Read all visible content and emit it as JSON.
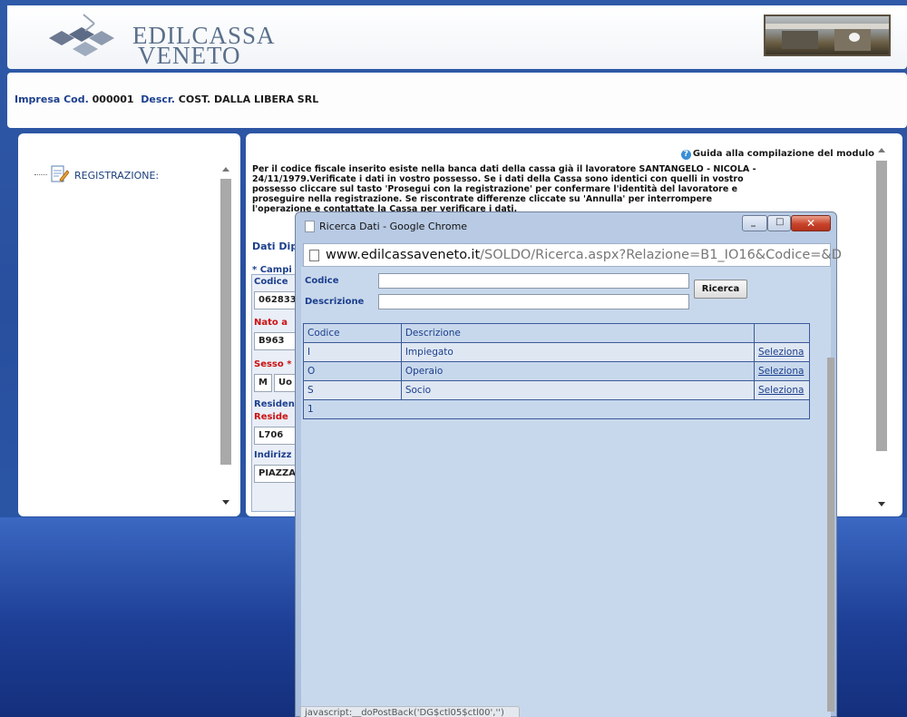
{
  "header": {
    "logo_line1": "EDILCASSA",
    "logo_line2": "VENETO"
  },
  "company": {
    "code_label": "Impresa Cod.",
    "code": "000001",
    "descr_label": "Descr.",
    "descr": "COST. DALLA LIBERA SRL"
  },
  "sidebar": {
    "items": [
      {
        "label": "REGISTRAZIONE:"
      }
    ]
  },
  "main": {
    "help_link": "Guida alla compilazione del modulo",
    "info_text": "Per il codice fiscale inserito esiste nella banca dati della cassa già il lavoratore SANTANGELO - NICOLA - 24/11/1979.Verificate i dati in vostro possesso. Se i dati della Cassa sono identici con quelli in vostro possesso cliccare sul tasto 'Prosegui con la registrazione' per confermare l'identità del lavoratore e proseguire nella registrazione. Se riscontrate differenze cliccate su 'Annulla' per interrompere l'operazione e contattate la Cassa per verificare i dati.",
    "section_title": "Dati Dip",
    "required_note": "* Campi",
    "fields": {
      "codice_label": "Codice",
      "codice_value": "062833",
      "nato_label": "Nato a",
      "nato_value": "B963",
      "sesso_label": "Sesso *",
      "sesso_code": "M",
      "sesso_desc": "Uo",
      "residenza_label": "Residen",
      "residenza_req_label": "Reside",
      "residenza_value": "L706",
      "indirizzo_label": "Indirizz",
      "indirizzo_value": "PIAZZA"
    }
  },
  "popup": {
    "title": "Ricerca Dati - Google Chrome",
    "url_host": "www.edilcassaveneto.it",
    "url_rest": "/SOLDO/Ricerca.aspx?Relazione=B1_IO16&Codice=&D",
    "codice_label": "Codice",
    "descrizione_label": "Descrizione",
    "codice_value": "",
    "descrizione_value": "",
    "search_button": "Ricerca",
    "table": {
      "headers": [
        "Codice",
        "Descrizione",
        ""
      ],
      "rows": [
        {
          "code": "I",
          "desc": "Impiegato",
          "action": "Seleziona"
        },
        {
          "code": "O",
          "desc": "Operaio",
          "action": "Seleziona"
        },
        {
          "code": "S",
          "desc": "Socio",
          "action": "Seleziona"
        }
      ],
      "pager": "1"
    },
    "status_bar": "javascript:__doPostBack('DG$ctl05$ctl00','')"
  }
}
